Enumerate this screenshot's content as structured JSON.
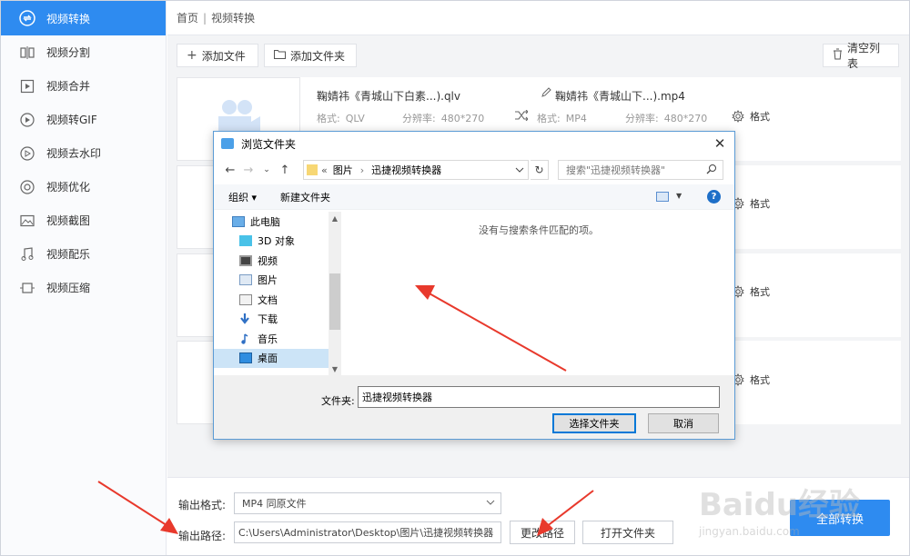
{
  "sidebar": {
    "items": [
      {
        "label": "视频转换",
        "icon": "convert-icon",
        "active": true
      },
      {
        "label": "视频分割",
        "icon": "split-icon"
      },
      {
        "label": "视频合并",
        "icon": "merge-icon"
      },
      {
        "label": "视频转GIF",
        "icon": "gif-icon"
      },
      {
        "label": "视频去水印",
        "icon": "watermark-icon"
      },
      {
        "label": "视频优化",
        "icon": "optimize-icon"
      },
      {
        "label": "视频截图",
        "icon": "screenshot-icon"
      },
      {
        "label": "视频配乐",
        "icon": "music-icon"
      },
      {
        "label": "视频压缩",
        "icon": "compress-icon"
      }
    ]
  },
  "breadcrumb": {
    "home": "首页",
    "sep": "|",
    "current": "视频转换"
  },
  "toolbar": {
    "add_file": "添加文件",
    "add_folder": "添加文件夹",
    "clear_list": "清空列表"
  },
  "file": {
    "source_name": "鞠婧祎《青城山下白素...).qlv",
    "source_format_label": "格式:",
    "source_format": "QLV",
    "source_res_label": "分辨率:",
    "source_res": "480*270",
    "target_name": "鞠婧祎《青城山下...).mp4",
    "target_format_label": "格式:",
    "target_format": "MP4",
    "target_res_label": "分辨率:",
    "target_res": "480*270",
    "format_btn": "格式"
  },
  "rows": [
    {
      "format_btn": "格式"
    },
    {
      "format_btn": "格式"
    },
    {
      "format_btn": "格式"
    }
  ],
  "bottom": {
    "output_format_label": "输出格式:",
    "output_format_value": "MP4  同原文件",
    "output_path_label": "输出路径:",
    "output_path_value": "C:\\Users\\Administrator\\Desktop\\图片\\迅捷视频转换器",
    "change_path": "更改路径",
    "open_folder": "打开文件夹",
    "convert_all": "全部转换"
  },
  "dialog": {
    "title": "浏览文件夹",
    "address_prefix": "«",
    "address_seg1": "图片",
    "address_sep": "›",
    "address_seg2": "迅捷视频转换器",
    "search_placeholder": "搜索\"迅捷视频转换器\"",
    "organize": "组织 ▾",
    "new_folder": "新建文件夹",
    "help": "?",
    "tree": [
      {
        "label": "此电脑",
        "root": true
      },
      {
        "label": "3D 对象"
      },
      {
        "label": "视频"
      },
      {
        "label": "图片"
      },
      {
        "label": "文档"
      },
      {
        "label": "下载"
      },
      {
        "label": "音乐"
      },
      {
        "label": "桌面",
        "selected": true
      }
    ],
    "empty_text": "没有与搜索条件匹配的项。",
    "folder_label": "文件夹:",
    "folder_value": "迅捷视频转换器",
    "select_btn": "选择文件夹",
    "cancel_btn": "取消"
  },
  "watermark": {
    "line1": "Baidu经验",
    "line2": "jingyan.baidu.com"
  },
  "colors": {
    "accent": "#2e8bf0",
    "arrow": "#e8392c"
  }
}
